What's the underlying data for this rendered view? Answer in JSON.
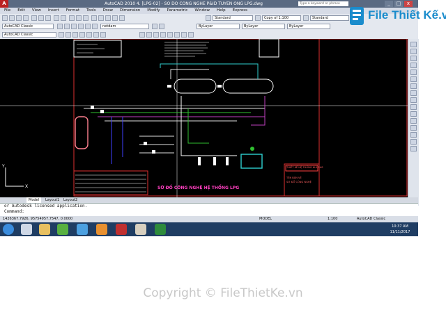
{
  "window": {
    "app_icon": "A",
    "title": "AutoCAD 2010    4. [LPG-02] - SO DO CONG NGHE P&ID TUYEN ONG LPG.dwg",
    "search_placeholder": "Type a keyword or phrase",
    "minimize": "_",
    "maximize": "□",
    "close": "x"
  },
  "menu": [
    "File",
    "Edit",
    "View",
    "Insert",
    "Format",
    "Tools",
    "Draw",
    "Dimension",
    "Modify",
    "Parametric",
    "Window",
    "Help",
    "Express"
  ],
  "toolbar": {
    "annotation_scale": "Copy of 1:100",
    "text_style": "Standard",
    "dim_style": "Standard",
    "workspace": "AutoCAD Classic",
    "layer": "netdam",
    "color": "ByLayer",
    "linetype": "ByLayer",
    "lineweight": "ByLayer",
    "plot_style": "Copy of 1:100"
  },
  "drawing": {
    "main_title": "SƠ ĐỒ CÔNG NGHỆ HỆ THỐNG LPG",
    "ucs_y": "Y",
    "ucs_x": "X",
    "title_block_lines": [
      "THIẾT KẾ HỆ THỐNG KHÍ GAS",
      "TÊN BẢN VẼ",
      "SƠ ĐỒ CÔNG NGHỆ"
    ]
  },
  "tabs": [
    "Model",
    "Layout1",
    "Layout2"
  ],
  "command": {
    "line1": "or Autodesk licensed application.",
    "line2": "Command:"
  },
  "status": {
    "coordinates": "1426367.7926, 95754957.7547, 0.0000",
    "model": "MODEL",
    "scale": "1:100",
    "workspace": "AutoCAD Classic"
  },
  "clock": {
    "time": "10:37 AM",
    "date": "11/11/2017"
  },
  "watermark": {
    "logo_text": "File Thiết Kế.vn",
    "copyright": "Copyright © FileThietKe.vn"
  },
  "colors": {
    "titlebar": "#5a6a82",
    "drawing_bg": "#000000",
    "taskbar": "#1f3d63",
    "brand": "#1a8ccc"
  }
}
